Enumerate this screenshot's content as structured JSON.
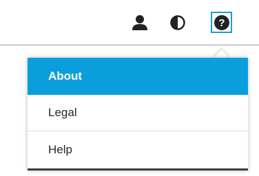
{
  "toolbar": {
    "icons": [
      "user-icon",
      "contrast-icon",
      "help-icon"
    ],
    "active_icon": "help-icon",
    "active_outline_color": "#1a9ad8"
  },
  "menu": {
    "items": [
      {
        "label": "About",
        "active": true
      },
      {
        "label": "Legal",
        "active": false
      },
      {
        "label": "Help",
        "active": false
      }
    ],
    "active_color": "#0a9fdc"
  }
}
